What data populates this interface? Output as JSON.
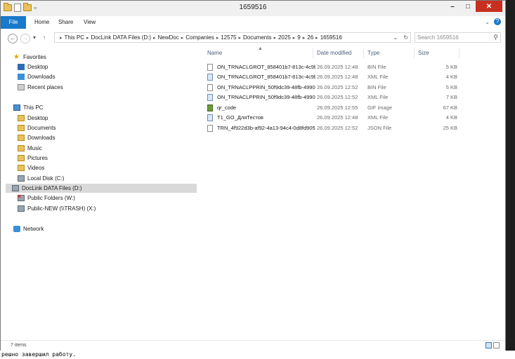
{
  "window": {
    "title": "1659516",
    "controls": [
      "minimize",
      "maximize",
      "close"
    ]
  },
  "ribbon": {
    "tabs": [
      "File",
      "Home",
      "Share",
      "View"
    ]
  },
  "navigation": {
    "breadcrumb": [
      "This PC",
      "DocLink DATA Files (D:)",
      "NewDoc",
      "Companies",
      "12575",
      "Documents",
      "2025",
      "9",
      "26",
      "1659516"
    ],
    "search_placeholder": "Search 1659516"
  },
  "nav_pane": {
    "favorites_label": "Favorites",
    "favorites": [
      "Desktop",
      "Downloads",
      "Recent places"
    ],
    "this_pc_label": "This PC",
    "this_pc_items": [
      "Desktop",
      "Documents",
      "Downloads",
      "Music",
      "Pictures",
      "Videos",
      "Local Disk (C:)",
      "DocLink DATA Files (D:)",
      "Public Folders (W:)",
      "Public-NEW (\\\\TRASH) (X:)"
    ],
    "network_label": "Network",
    "selected": "DocLink DATA Files (D:)"
  },
  "columns": [
    "Name",
    "Date modified",
    "Type",
    "Size"
  ],
  "files": [
    {
      "name": "ON_TRNACLGROT_858401b7-813c-4c9b-...",
      "date": "26.09.2025 12:48",
      "type": "BIN File",
      "size": "5 KB",
      "icon": "bin"
    },
    {
      "name": "ON_TRNACLGROT_858401b7-813c-4c9b-...",
      "date": "26.09.2025 12:48",
      "type": "XML File",
      "size": "4 KB",
      "icon": "xml"
    },
    {
      "name": "ON_TRNACLPPRIN_50f9dc39-48fb-4990-...",
      "date": "26.09.2025 12:52",
      "type": "BIN File",
      "size": "5 KB",
      "icon": "bin"
    },
    {
      "name": "ON_TRNACLPPRIN_50f9dc39-48fb-4990-...",
      "date": "26.09.2025 12:52",
      "type": "XML File",
      "size": "7 KB",
      "icon": "xml"
    },
    {
      "name": "qr_code",
      "date": "26.09.2025 12:55",
      "type": "GIF image",
      "size": "67 KB",
      "icon": "gif"
    },
    {
      "name": "T1_GO_ДляТестов",
      "date": "26.09.2025 12:48",
      "type": "XML File",
      "size": "4 KB",
      "icon": "xml"
    },
    {
      "name": "TRN_4f922d3b-af92-4a13-94c4-0d8fd905...",
      "date": "26.09.2025 12:52",
      "type": "JSON File",
      "size": "25 KB",
      "icon": "json"
    }
  ],
  "status": {
    "items_count": "7 items"
  },
  "console": {
    "text": "решно завершил работу."
  },
  "colors": {
    "accent": "#1979ca",
    "close": "#c7301f",
    "selected_bg": "#d9d9d9"
  }
}
